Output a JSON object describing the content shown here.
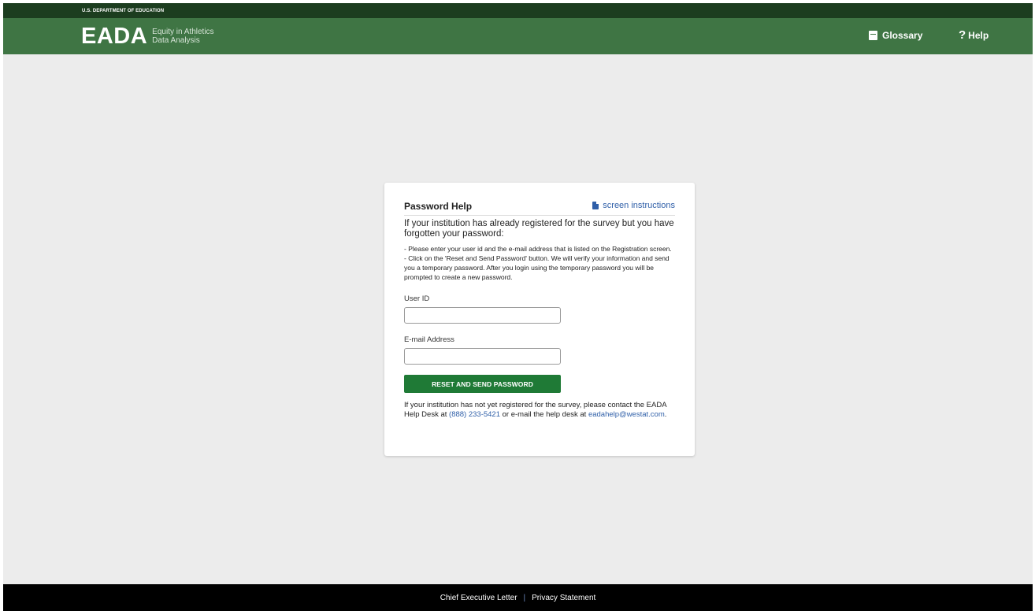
{
  "topbar": {
    "agency": "U.S. DEPARTMENT OF EDUCATION"
  },
  "header": {
    "logo_main": "EADA",
    "logo_sub_line1": "Equity in Athletics",
    "logo_sub_line2": "Data Analysis",
    "nav": {
      "glossary": "Glossary",
      "help": "Help",
      "glossary_icon": "book-icon",
      "help_icon": "question-icon"
    }
  },
  "card": {
    "title": "Password Help",
    "instructions_link": "screen instructions",
    "instructions_icon": "pdf-file-icon",
    "intro": "If your institution has already registered for the survey but you have forgotten your password:",
    "bullet1": "- Please enter your user id and the e-mail address that is listed on the Registration screen.",
    "bullet2": "- Click on the 'Reset and Send Password' button. We will verify your information and send you a temporary password. After you login using the temporary password you will be prompted to create a new password.",
    "user_id_label": "User ID",
    "user_id_value": "",
    "email_label": "E-mail Address",
    "email_value": "",
    "submit_label": "RESET AND SEND PASSWORD",
    "note_before_phone": "If your institution has not yet registered for the survey, please contact the EADA Help Desk at ",
    "phone": "(888) 233-5421",
    "note_middle": " or e-mail the help desk at ",
    "email_link": "eadahelp@westat.com",
    "note_end": "."
  },
  "footer": {
    "link1": "Chief Executive Letter",
    "separator": "|",
    "link2": "Privacy Statement"
  },
  "colors": {
    "topbar": "#1c3d1f",
    "header": "#3f7544",
    "button": "#1f7a36",
    "link": "#2f5fa8",
    "background": "#ececec",
    "footer": "#000000"
  }
}
